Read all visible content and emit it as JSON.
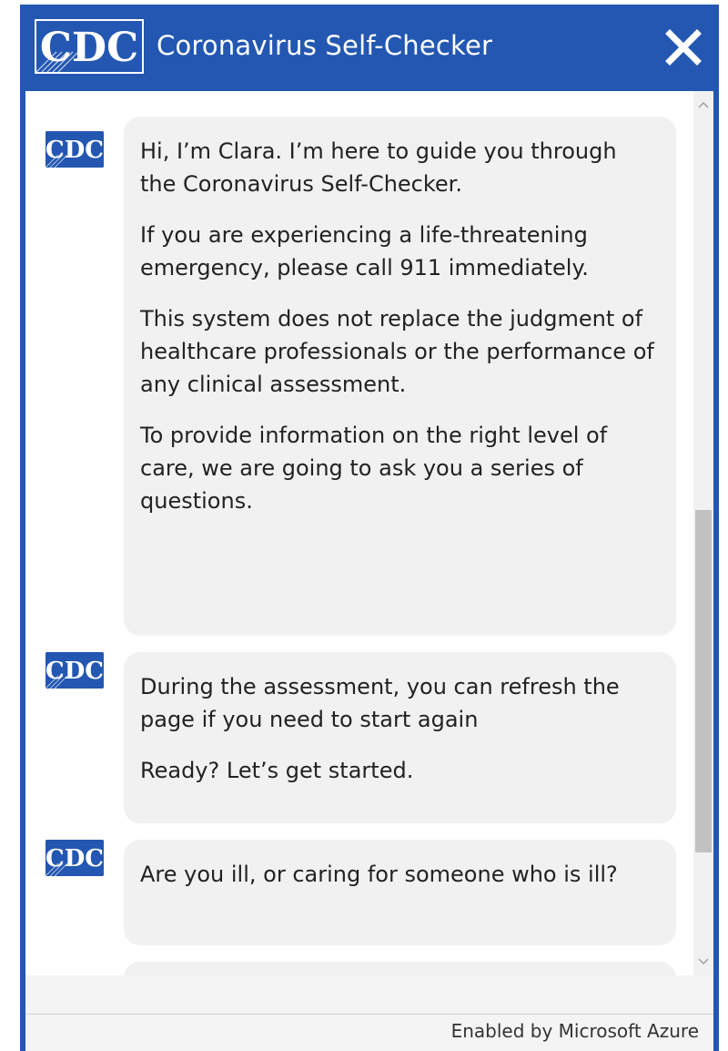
{
  "header": {
    "logo_text": "CDC",
    "title": "Coronavirus Self-Checker",
    "close_icon": "close-icon"
  },
  "colors": {
    "brand_blue": "#2357b1",
    "bubble_bg": "#f1f1f1",
    "text": "#222222"
  },
  "messages": [
    {
      "avatar_text": "CDC",
      "paragraphs": [
        "Hi, I’m Clara. I’m here to guide you through the Coronavirus Self-Checker.",
        "If you are experiencing a life-threatening emergency, please call 911 immediately.",
        "This system does not replace the judgment of healthcare professionals or the performance of any clinical assessment.",
        "To provide information on the right level of care, we are going to ask you a series of questions."
      ]
    },
    {
      "avatar_text": "CDC",
      "paragraphs": [
        "During the assessment, you can refresh the page if you need to start again",
        "Ready? Let’s get started."
      ]
    },
    {
      "avatar_text": "CDC",
      "paragraphs": [
        "Are you ill, or caring for someone who is ill?"
      ]
    }
  ],
  "footer": {
    "text": "Enabled by Microsoft Azure"
  }
}
